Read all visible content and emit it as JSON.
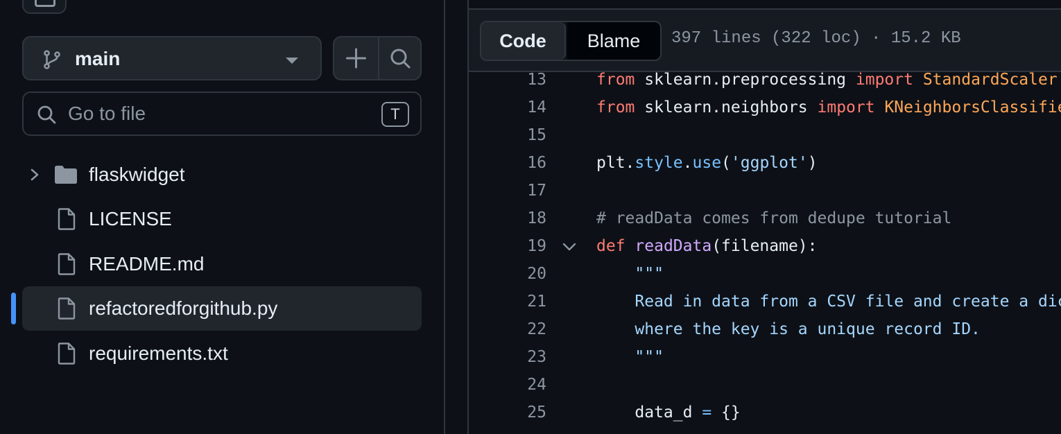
{
  "sidebar": {
    "branch": {
      "label": "main"
    },
    "goto_file": {
      "placeholder": "Go to file",
      "shortcut": "T"
    },
    "tree": [
      {
        "type": "folder",
        "name": "flaskwidget",
        "icon": "folder-icon"
      },
      {
        "type": "file",
        "name": "LICENSE",
        "icon": "file-icon"
      },
      {
        "type": "file",
        "name": "README.md",
        "icon": "file-icon"
      },
      {
        "type": "file",
        "name": "refactoredforgithub.py",
        "icon": "file-icon",
        "active": true
      },
      {
        "type": "file",
        "name": "requirements.txt",
        "icon": "file-icon"
      }
    ]
  },
  "code_view": {
    "tabs": {
      "code": "Code",
      "blame": "Blame"
    },
    "file_meta": "397 lines (322 loc) · 15.2 KB",
    "lines": [
      {
        "n": "13",
        "tokens": [
          {
            "t": "from",
            "c": "kw"
          },
          {
            "t": " sklearn.preprocessing ",
            "c": ""
          },
          {
            "t": "import",
            "c": "kw"
          },
          {
            "t": " StandardScaler",
            "c": "cls"
          }
        ]
      },
      {
        "n": "14",
        "tokens": [
          {
            "t": "from",
            "c": "kw"
          },
          {
            "t": " sklearn.neighbors ",
            "c": ""
          },
          {
            "t": "import",
            "c": "kw"
          },
          {
            "t": " KNeighborsClassifier",
            "c": "cls"
          }
        ]
      },
      {
        "n": "15",
        "tokens": []
      },
      {
        "n": "16",
        "tokens": [
          {
            "t": "plt.",
            "c": ""
          },
          {
            "t": "style",
            "c": "prop"
          },
          {
            "t": ".",
            "c": ""
          },
          {
            "t": "use",
            "c": "prop"
          },
          {
            "t": "(",
            "c": ""
          },
          {
            "t": "'ggplot'",
            "c": "str"
          },
          {
            "t": ")",
            "c": ""
          }
        ]
      },
      {
        "n": "17",
        "tokens": []
      },
      {
        "n": "18",
        "tokens": [
          {
            "t": "# readData comes from dedupe tutorial",
            "c": "cmt"
          }
        ]
      },
      {
        "n": "19",
        "fold": true,
        "tokens": [
          {
            "t": "def",
            "c": "kw"
          },
          {
            "t": " ",
            "c": ""
          },
          {
            "t": "readData",
            "c": "fn"
          },
          {
            "t": "(filename):",
            "c": ""
          }
        ]
      },
      {
        "n": "20",
        "tokens": [
          {
            "t": "    \"\"\"",
            "c": "str"
          }
        ]
      },
      {
        "n": "21",
        "tokens": [
          {
            "t": "    Read in data from a CSV file and create a dictionary of records,",
            "c": "str"
          }
        ]
      },
      {
        "n": "22",
        "tokens": [
          {
            "t": "    where the key is a unique record ID.",
            "c": "str"
          }
        ]
      },
      {
        "n": "23",
        "tokens": [
          {
            "t": "    \"\"\"",
            "c": "str"
          }
        ]
      },
      {
        "n": "24",
        "tokens": []
      },
      {
        "n": "25",
        "tokens": [
          {
            "t": "    data_d ",
            "c": ""
          },
          {
            "t": "=",
            "c": "op"
          },
          {
            "t": " {}",
            "c": ""
          }
        ]
      }
    ]
  },
  "colors": {
    "accent": "#4493f8",
    "bg": "#0d1117",
    "border": "#30363d"
  }
}
